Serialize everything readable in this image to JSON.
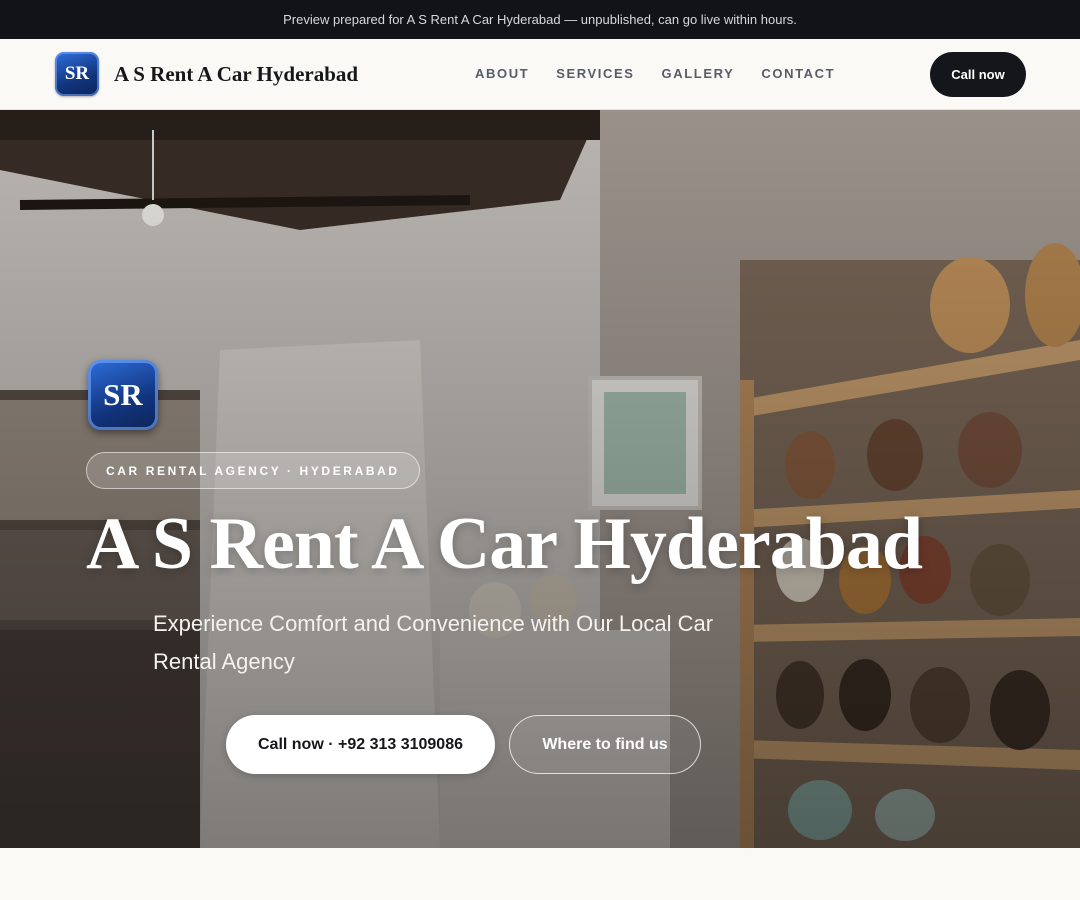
{
  "preview_banner": {
    "text": "Preview prepared for A S Rent A Car Hyderabad — unpublished, can go live within hours."
  },
  "nav": {
    "logo_text": "SR",
    "brand_name": "A S Rent A Car Hyderabad",
    "links": [
      {
        "label": "ABOUT"
      },
      {
        "label": "SERVICES"
      },
      {
        "label": "GALLERY"
      },
      {
        "label": "CONTACT"
      }
    ],
    "cta_label": "Call now"
  },
  "hero": {
    "logo_text": "SR",
    "tag": "CAR RENTAL AGENCY · HYDERABAD",
    "title": "A S Rent A Car Hyderabad",
    "subtitle": "Experience Comfort and Convenience with Our Local Car Rental Agency",
    "primary_button": "Call now · +92 313 3109086",
    "secondary_button": "Where to find us",
    "background_image": "shop-interior-with-wooden-shelves-and-jars-photo"
  },
  "colors": {
    "banner_bg": "#111318",
    "nav_cta_bg": "#14161b",
    "logo_blue": "#1f4fb0",
    "page_bg": "#faf9f6"
  }
}
